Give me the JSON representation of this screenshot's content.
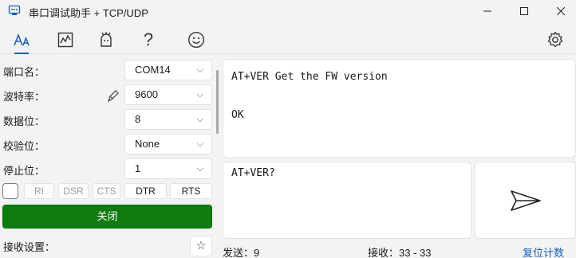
{
  "window": {
    "title": "串口调试助手 + TCP/UDP"
  },
  "toolbar": {
    "icons": [
      "text-mode-icon",
      "waveform-icon",
      "plugin-icon",
      "help-icon",
      "emoji-icon",
      "settings-icon"
    ]
  },
  "port": {
    "fields": [
      {
        "label": "端口名：",
        "value": "COM14"
      },
      {
        "label": "波特率：",
        "value": "9600"
      },
      {
        "label": "数据位：",
        "value": "8"
      },
      {
        "label": "校验位：",
        "value": "None"
      },
      {
        "label": "停止位：",
        "value": "1"
      }
    ],
    "signals": [
      "RI",
      "DSR",
      "CTS",
      "DTR",
      "RTS"
    ],
    "close_label": "关闭",
    "recv_settings_label": "接收设置："
  },
  "receive": {
    "text": "AT+VER Get the FW version\n\nOK"
  },
  "send": {
    "text": "AT+VER?"
  },
  "status": {
    "sent_label": "发送：",
    "sent_value": "9",
    "recv_label": "接收：",
    "recv_value": "33 - 33",
    "reset_label": "复位计数"
  },
  "colors": {
    "accent": "#1a5fb4",
    "close_button": "#107c10"
  }
}
